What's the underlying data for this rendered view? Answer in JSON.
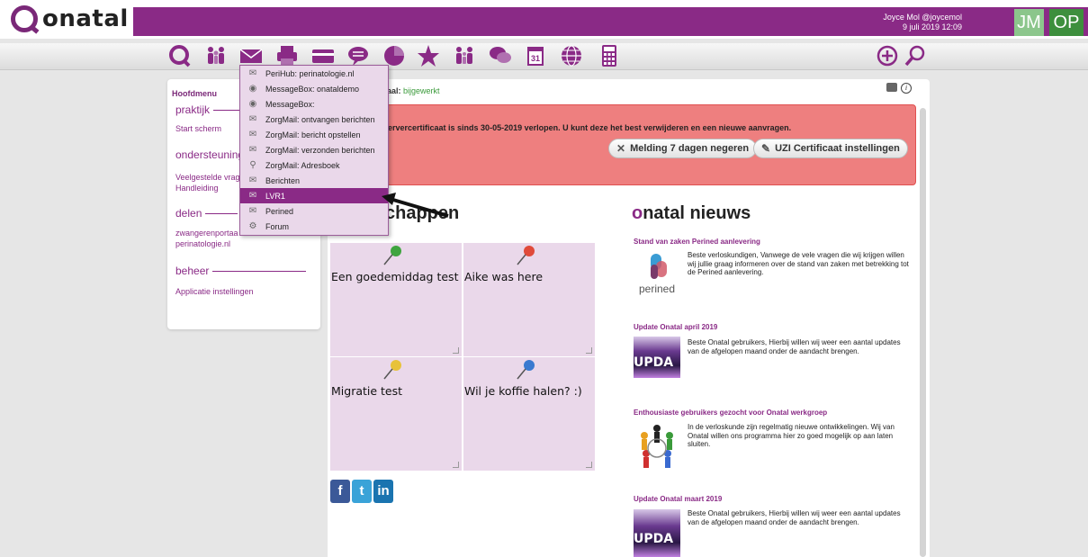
{
  "header": {
    "app_name": "onatal",
    "user": "Joyce Mol @joycemol",
    "datetime": "9 juli 2019 12:09",
    "avatar1": "JM",
    "avatar2": "OP",
    "accent": "#8a2a86"
  },
  "toolbar": {
    "icons": [
      "home-logo-icon",
      "people-icon",
      "mail-icon",
      "printer-icon",
      "card-icon",
      "chat-icon",
      "pie-chart-icon",
      "star-icon",
      "family-icon",
      "comments-icon",
      "calendar-icon",
      "globe-icon",
      "calculator-icon",
      "plus-circle-icon",
      "magnifier-icon"
    ],
    "calendar_day": "31"
  },
  "sidebar": {
    "title": "Hoofdmenu",
    "sections": [
      {
        "label": "praktijk",
        "items": [
          "Start scherm"
        ]
      },
      {
        "label": "ondersteuning",
        "items": [
          "Veelgestelde vrag",
          "Handleiding"
        ]
      },
      {
        "label": "delen",
        "items": [
          "zwangerenportaa",
          "perinatologie.nl"
        ]
      },
      {
        "label": "beheer",
        "items": [
          "Applicatie instellingen"
        ]
      }
    ]
  },
  "main": {
    "crumb_prefix": "aal",
    "crumb_status": "bijgewerkt",
    "alert": {
      "message": "ervercertificaat is sinds 30-05-2019 verlopen. U kunt deze het best verwijderen en een nieuwe aanvragen.",
      "button1": "Melding 7 dagen negeren",
      "button2": "UZI Certificaat instellingen"
    },
    "notes_title": "chappen",
    "notes": [
      {
        "text": "Een goedemiddag test",
        "pin_color": "#3fa43f"
      },
      {
        "text": "Aike was here",
        "pin_color": "#e04a3a"
      },
      {
        "text": "Migratie test",
        "pin_color": "#e8c23a"
      },
      {
        "text": "Wil je koffie halen? :)",
        "pin_color": "#3a7ad0"
      }
    ],
    "social": [
      "f",
      "t",
      "in"
    ]
  },
  "news": {
    "title_brand": "o",
    "title_rest": "natal nieuws",
    "items": [
      {
        "heading": "Stand van zaken Perined aanlevering",
        "body": "Beste verloskundigen, Vanwege de vele vragen die wij krijgen willen wij jullie graag informeren over de stand van zaken met betrekking tot de Perined aanlevering.",
        "thumb_label": "perined"
      },
      {
        "heading": "Update Onatal april 2019",
        "body": "Beste Onatal gebruikers, Hierbij willen wij weer een aantal updates van de afgelopen maand onder de aandacht brengen.",
        "thumb_label": "UPDA"
      },
      {
        "heading": "Enthousiaste gebruikers gezocht voor Onatal werkgroep",
        "body": "In de verloskunde zijn regelmatig nieuwe ontwikkelingen. Wij van Onatal willen ons programma hier zo goed mogelijk op aan laten sluiten.",
        "thumb_label": ""
      },
      {
        "heading": "Update Onatal maart 2019",
        "body": "Beste Onatal gebruikers, Hierbij willen wij weer een aantal updates van de afgelopen maand onder de aandacht brengen.",
        "thumb_label": "UPDA"
      }
    ]
  },
  "dropdown": {
    "items": [
      {
        "label": "PeriHub: perinatologie.nl",
        "icon": "envelope-icon"
      },
      {
        "label": "MessageBox: onataldemo",
        "icon": "eye-icon"
      },
      {
        "label": "MessageBox:",
        "icon": "eye-icon"
      },
      {
        "label": "ZorgMail: ontvangen berichten",
        "icon": "envelope-icon"
      },
      {
        "label": "ZorgMail: bericht opstellen",
        "icon": "envelope-icon"
      },
      {
        "label": "ZorgMail: verzonden berichten",
        "icon": "envelope-icon"
      },
      {
        "label": "ZorgMail: Adresboek",
        "icon": "magnifier-icon"
      },
      {
        "label": "Berichten",
        "icon": "envelope-icon"
      },
      {
        "label": "LVR1",
        "icon": "envelope-icon",
        "active": true
      },
      {
        "label": "Perined",
        "icon": "envelope-icon"
      },
      {
        "label": "Forum",
        "icon": "gear-icon"
      }
    ]
  }
}
